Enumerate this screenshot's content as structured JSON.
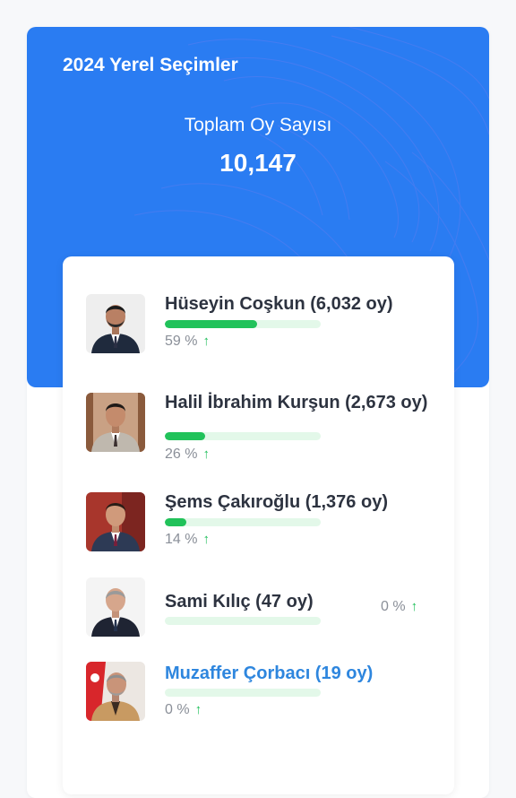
{
  "header": {
    "title": "2024 Yerel Seçimler",
    "total_label": "Toplam Oy Sayısı",
    "total_value": "10,147"
  },
  "colors": {
    "hero_background": "#2a7cf2",
    "bar_fill": "#21c25a",
    "bar_track": "#e3f8e9",
    "trend_up": "#1fbf5a",
    "link": "#2e86de"
  },
  "candidates": [
    {
      "name": "Hüseyin Coşkun (6,032 oy)",
      "percent_label": "59 %",
      "share": 0.59,
      "trend_icon": "arrow-up-icon"
    },
    {
      "name": "Halil İbrahim Kurşun (2,673 oy)",
      "percent_label": "26 %",
      "share": 0.26,
      "trend_icon": "arrow-up-icon"
    },
    {
      "name": "Şems Çakıroğlu (1,376 oy)",
      "percent_label": "14 %",
      "share": 0.14,
      "trend_icon": "arrow-up-icon"
    },
    {
      "name": "Sami Kılıç (47 oy)",
      "percent_label": "0 %",
      "share": 0.0,
      "trend_icon": "arrow-up-icon"
    },
    {
      "name": "Muzaffer Çorbacı (19 oy)",
      "percent_label": "0 %",
      "share": 0.0,
      "trend_icon": "arrow-up-icon"
    }
  ]
}
